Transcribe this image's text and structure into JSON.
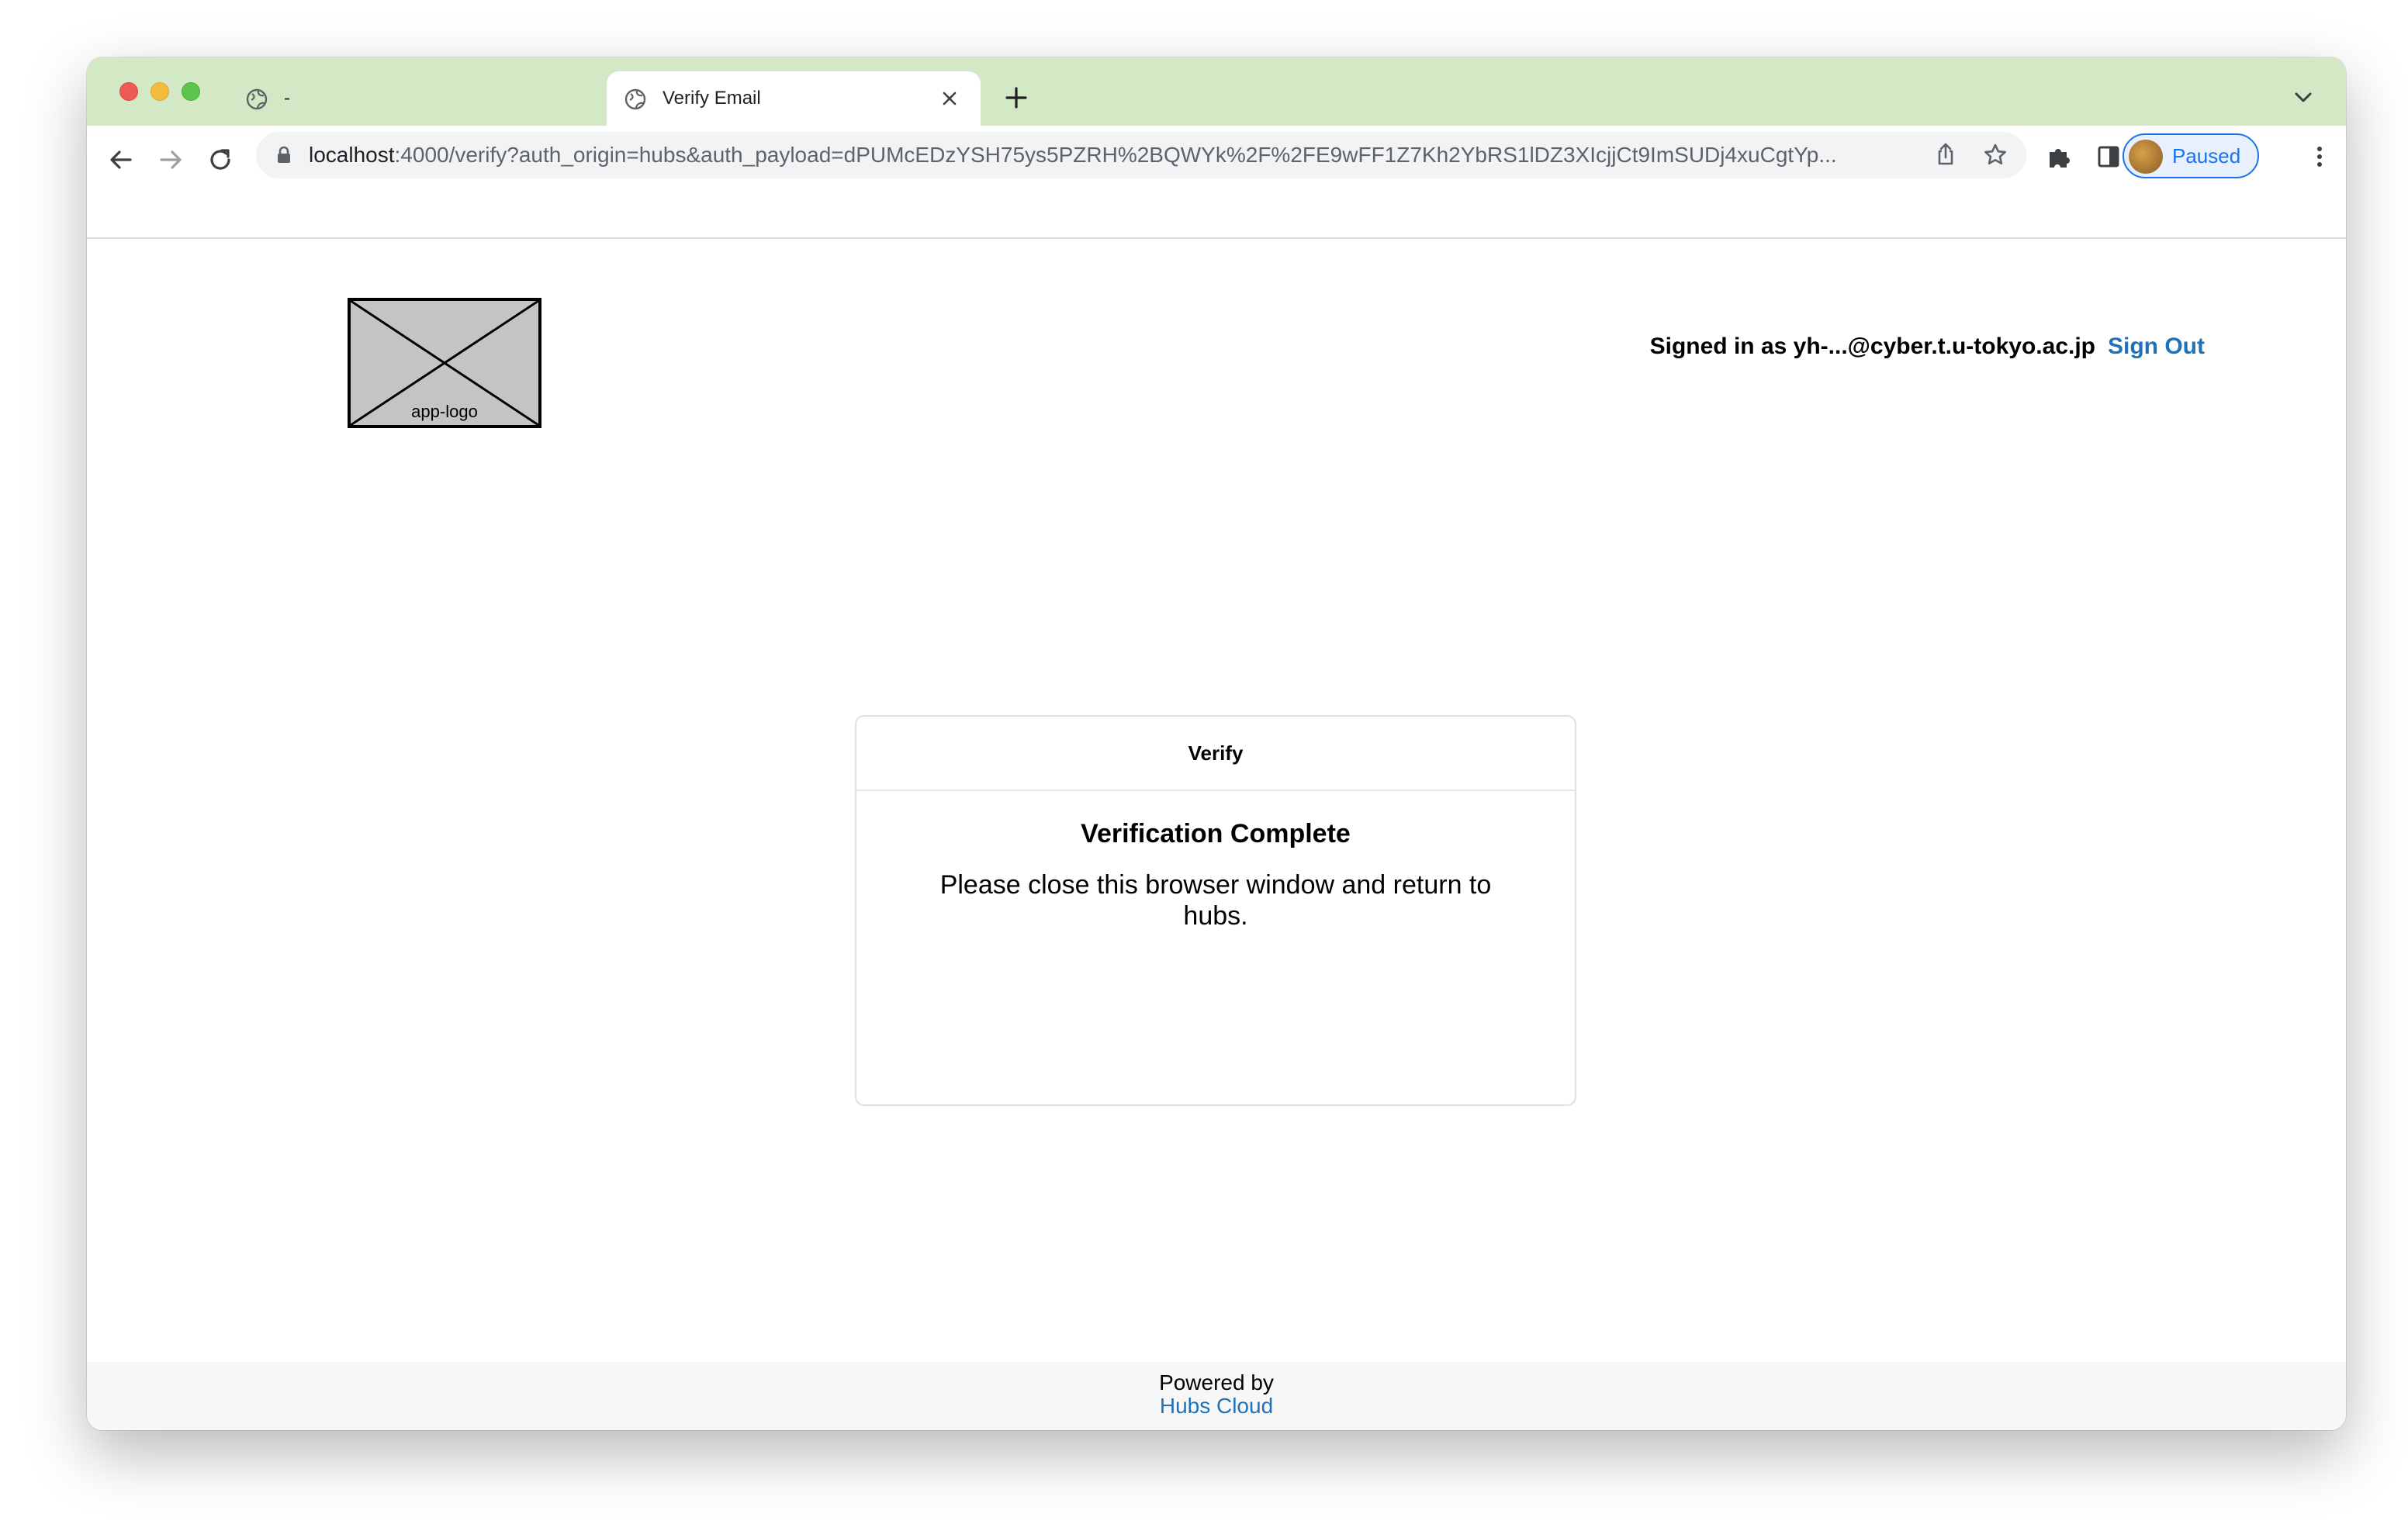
{
  "browser": {
    "tabs": [
      {
        "title": "-",
        "active": false
      },
      {
        "title": "Verify Email",
        "active": true
      }
    ],
    "url_host": "localhost",
    "url_rest": ":4000/verify?auth_origin=hubs&auth_payload=dPUMcEDzYSH75ys5PZRH%2BQWYk%2F%2FE9wFF1Z7Kh2YbRS1lDZ3XIcjjCt9ImSUDj4xuCgtYp...",
    "profile_label": "Paused"
  },
  "header": {
    "logo_alt": "app-logo",
    "signed_in_text": "Signed in as yh-...@cyber.t.u-tokyo.ac.jp",
    "sign_out_label": "Sign Out"
  },
  "card": {
    "header": "Verify",
    "title": "Verification Complete",
    "message": "Please close this browser window and return to hubs."
  },
  "footer": {
    "powered_by": "Powered by",
    "link_label": "Hubs Cloud"
  },
  "colors": {
    "tabstrip": "#d3e9c5",
    "link": "#1f71b8",
    "profile_accent": "#1a73e8"
  }
}
